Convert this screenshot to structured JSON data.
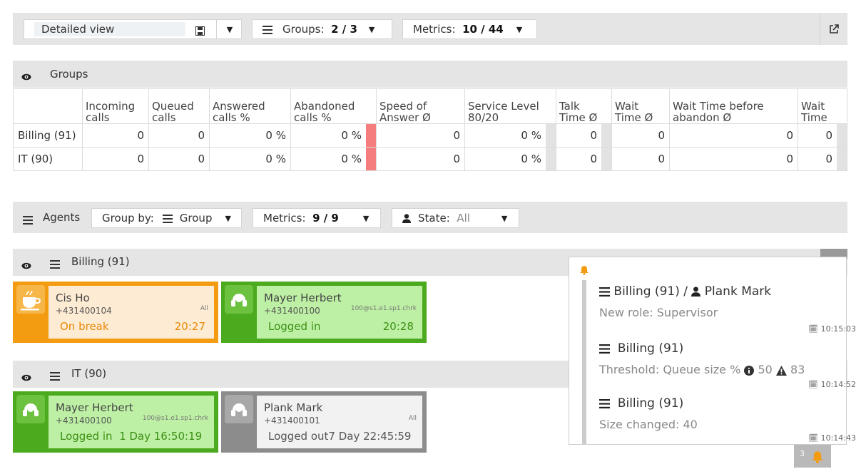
{
  "toolbar": {
    "view_name": "Detailed view",
    "groups_label": "Groups:",
    "groups_value": "2 / 3",
    "metrics_label": "Metrics:",
    "metrics_value": "10 / 44"
  },
  "groups_section": {
    "title": "Groups",
    "columns": [
      "Incoming calls",
      "Queued calls",
      "Answered calls %",
      "Abandoned calls %",
      "Speed of Answer Ø",
      "Service Level 80/20",
      "Talk Time Ø",
      "Wait Time Ø",
      "Wait Time before abandon Ø",
      "Wait Time"
    ],
    "rows": [
      {
        "label": "Billing (91)",
        "incoming": "0",
        "queued": "0",
        "answered": "0 %",
        "abandoned": "0 %",
        "speed": "0",
        "service": "0 %",
        "talk": "0",
        "wait": "0",
        "wait_before": "0",
        "wait_time": "0"
      },
      {
        "label": "IT (90)",
        "incoming": "0",
        "queued": "0",
        "answered": "0 %",
        "abandoned": "0 %",
        "speed": "0",
        "service": "0 %",
        "talk": "0",
        "wait": "0",
        "wait_before": "0",
        "wait_time": "0"
      }
    ]
  },
  "agents_bar": {
    "title": "Agents",
    "group_by_label": "Group by:",
    "group_by_value": "Group",
    "metrics_label": "Metrics:",
    "metrics_value": "9 / 9",
    "state_label": "State:",
    "state_value": "All"
  },
  "billing_group": {
    "title": "Billing (91)",
    "agents": [
      {
        "name": "Cis Ho",
        "phone": "+431400104",
        "ext": "All",
        "status": "On break",
        "time": "20:27"
      },
      {
        "name": "Mayer Herbert",
        "phone": "+431400100",
        "ext": "100@s1.e1.sp1.chrk",
        "status": "Logged in",
        "time": "20:28"
      }
    ]
  },
  "it_group": {
    "title": "IT (90)",
    "agents": [
      {
        "name": "Mayer Herbert",
        "phone": "+431400100",
        "ext": "100@s1.e1.sp1.chrk",
        "status": "Logged in",
        "time": "1 Day 16:50:19"
      },
      {
        "name": "Plank Mark",
        "phone": "+431400101",
        "ext": "All",
        "status": "Logged out",
        "time": "7 Day 22:45:59"
      }
    ]
  },
  "notifications": {
    "count": "3",
    "items": [
      {
        "group": "Billing (91)",
        "separator": "/",
        "agent": "Plank Mark",
        "text": "New role: Supervisor",
        "time": "10:15:03"
      },
      {
        "group": "Billing (91)",
        "label": "Threshold: Queue size %",
        "info_value": "50",
        "warn_value": "83",
        "time": "10:14:52"
      },
      {
        "group": "Billing (91)",
        "text": "Size changed: 40",
        "time": "10:14:43"
      }
    ]
  },
  "colors": {
    "break": "#f39c12",
    "break_bg": "#fdebd3",
    "logged_in": "#4caa1e",
    "logged_in_bg": "#bdf0a4",
    "logged_out": "#8c8c8c",
    "logged_out_bg": "#f2f2f2",
    "abandon_alert": "#f57d7d",
    "bell": "#f39c12"
  },
  "icons": [
    "save-icon",
    "list-icon",
    "external-link-icon",
    "eye-icon",
    "hamburger-icon",
    "user-icon",
    "coffee-icon",
    "headset-icon",
    "bell-icon",
    "calendar-icon",
    "info-icon",
    "warning-icon"
  ]
}
